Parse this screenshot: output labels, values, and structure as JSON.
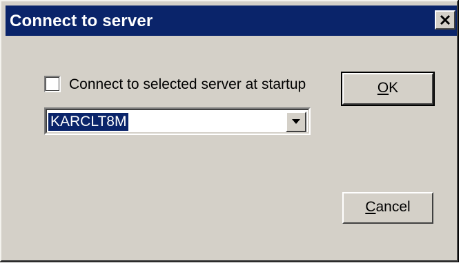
{
  "window": {
    "title": "Connect to server",
    "close_glyph": "✕"
  },
  "startup_option": {
    "label": "Connect to selected server at startup",
    "checked": false
  },
  "server_combo": {
    "value": "KARCLT8M"
  },
  "buttons": {
    "ok_mnemonic": "O",
    "ok_rest": "K",
    "cancel_mnemonic": "C",
    "cancel_rest": "ancel"
  },
  "colors": {
    "titlebar": "#0a246a",
    "face": "#d4d0c8",
    "selection": "#0a246a"
  }
}
